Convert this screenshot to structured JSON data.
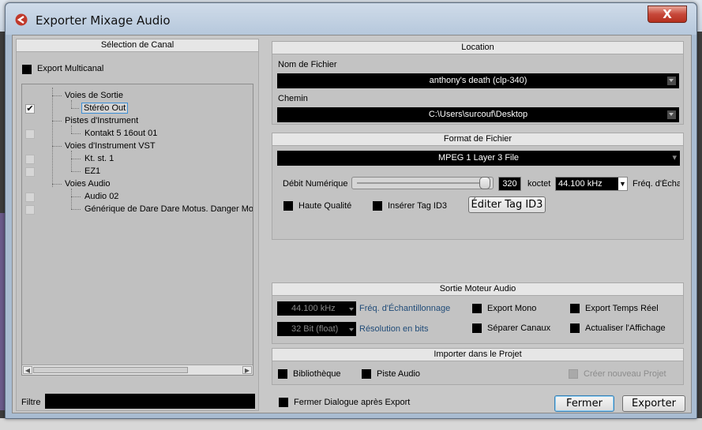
{
  "window": {
    "title": "Exporter Mixage Audio",
    "close": "X"
  },
  "selection": {
    "header": "Sélection de Canal",
    "export_multicanal": "Export Multicanal",
    "tree": [
      {
        "label": "Voies de Sortie"
      },
      {
        "label": "Stéréo Out"
      },
      {
        "label": "Pistes d'Instrument"
      },
      {
        "label": "Kontakt 5 16out 01"
      },
      {
        "label": "Voies d'Instrument VST"
      },
      {
        "label": "Kt. st. 1"
      },
      {
        "label": "EZ1"
      },
      {
        "label": "Voies Audio"
      },
      {
        "label": "Audio 02"
      },
      {
        "label": "Générique de Dare Dare Motus. Danger Mou"
      }
    ],
    "filter_label": "Filtre",
    "filter_value": ""
  },
  "location": {
    "header": "Location",
    "filename_label": "Nom de Fichier",
    "filename": "anthony's death (clp-340)",
    "path_label": "Chemin",
    "path": "C:\\Users\\surcouf\\Desktop"
  },
  "format": {
    "header": "Format de Fichier",
    "type": "MPEG 1 Layer 3 File",
    "bitrate_label": "Débit Numérique",
    "bitrate_value": "320",
    "bitrate_unit": "koctet",
    "bitrate_level": 1.0,
    "samplerate": "44.100 kHz",
    "samplerate_label": "Fréq. d'Écha",
    "high_quality": "Haute Qualité",
    "insert_id3": "Insérer Tag ID3",
    "edit_id3": "Éditer Tag ID3"
  },
  "engine": {
    "header": "Sortie Moteur Audio",
    "rate_value": "44.100 kHz",
    "rate_label": "Fréq. d'Échantillonnage",
    "res_value": "32 Bit (float)",
    "res_label": "Résolution en bits",
    "export_mono": "Export Mono",
    "separate_channels": "Séparer Canaux",
    "realtime": "Export Temps Réel",
    "update_display": "Actualiser l'Affichage"
  },
  "import": {
    "header": "Importer dans le Projet",
    "library": "Bibliothèque",
    "audio_track": "Piste Audio",
    "new_project": "Créer nouveau Projet"
  },
  "footer": {
    "close_after": "Fermer Dialogue après Export",
    "close_btn": "Fermer",
    "export_btn": "Exporter"
  }
}
